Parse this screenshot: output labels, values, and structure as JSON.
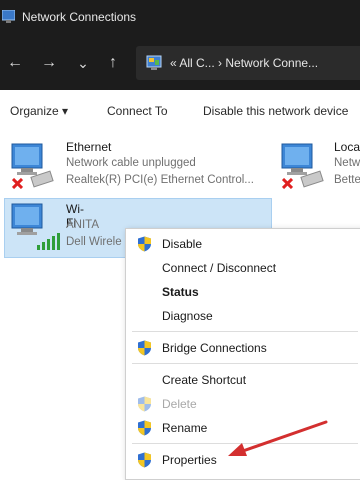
{
  "window": {
    "title": "Network Connections"
  },
  "address": {
    "path": "« All C...  ›  Network Conne..."
  },
  "nav": {
    "back": "←",
    "forward": "→",
    "recent": "⌄",
    "up": "↑"
  },
  "toolbar": {
    "organize_label": "Organize ▾",
    "connect_label": "Connect To",
    "disable_label": "Disable this network device"
  },
  "adapters": {
    "ethernet": {
      "name": "Ethernet",
      "status": "Network cable unplugged",
      "device": "Realtek(R) PCI(e) Ethernet Control..."
    },
    "local": {
      "name": "Loca",
      "status": "Netw",
      "device": "Bette"
    },
    "wifi": {
      "name": "Wi-Fi",
      "status": "ANITA",
      "device": "Dell Wirele"
    }
  },
  "context_menu": {
    "disable": "Disable",
    "connect_disconnect": "Connect / Disconnect",
    "status": "Status",
    "diagnose": "Diagnose",
    "bridge": "Bridge Connections",
    "create_shortcut": "Create Shortcut",
    "delete": "Delete",
    "rename": "Rename",
    "properties": "Properties"
  },
  "colors": {
    "accent": "#d32f2f",
    "selection": "#cce4f7",
    "titlebar": "#1c1c1c"
  }
}
